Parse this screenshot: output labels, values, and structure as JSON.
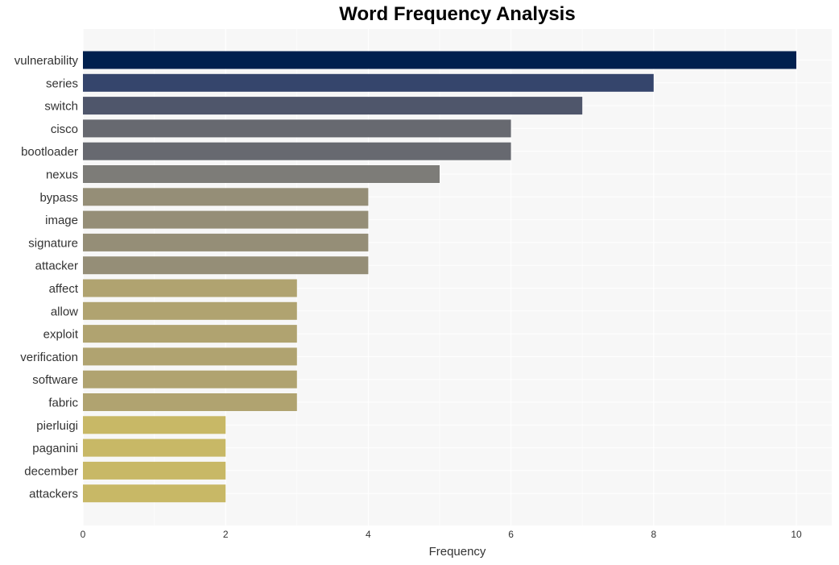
{
  "chart_data": {
    "type": "bar",
    "orientation": "horizontal",
    "title": "Word Frequency Analysis",
    "xlabel": "Frequency",
    "ylabel": "",
    "xlim": [
      0,
      10.5
    ],
    "xticks": [
      0,
      2,
      4,
      6,
      8,
      10
    ],
    "grid": true,
    "categories": [
      "vulnerability",
      "series",
      "switch",
      "cisco",
      "bootloader",
      "nexus",
      "bypass",
      "image",
      "signature",
      "attacker",
      "affect",
      "allow",
      "exploit",
      "verification",
      "software",
      "fabric",
      "pierluigi",
      "paganini",
      "december",
      "attackers"
    ],
    "values": [
      10,
      8,
      7,
      6,
      6,
      5,
      4,
      4,
      4,
      4,
      3,
      3,
      3,
      3,
      3,
      3,
      2,
      2,
      2,
      2
    ],
    "colors": [
      "#00204e",
      "#35456c",
      "#4f566b",
      "#676970",
      "#676970",
      "#7d7c78",
      "#958e77",
      "#958e77",
      "#958e77",
      "#958e77",
      "#b0a370",
      "#b0a370",
      "#b0a370",
      "#b0a370",
      "#b0a370",
      "#b0a370",
      "#c8b866",
      "#c8b866",
      "#c8b866",
      "#c8b866"
    ]
  }
}
